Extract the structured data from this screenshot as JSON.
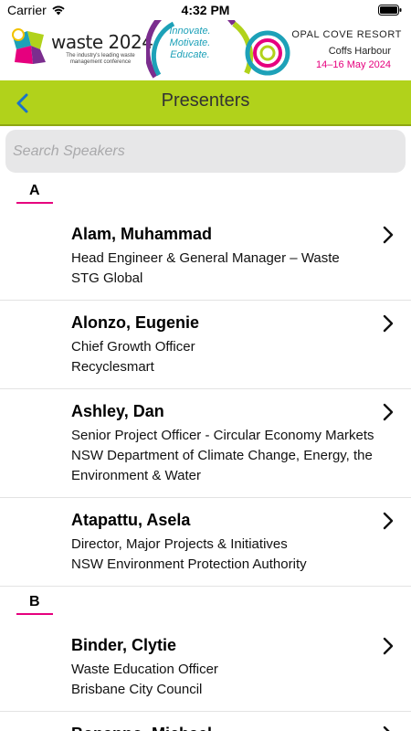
{
  "status_bar": {
    "carrier": "Carrier",
    "time": "4:32 PM"
  },
  "banner": {
    "logo_title": "waste 2024",
    "logo_tagline": "The industry's leading waste management conference",
    "motto": [
      "Innovate.",
      "Motivate.",
      "Educate."
    ],
    "venue": "OPAL COVE RESORT",
    "city": "Coffs Harbour",
    "dates": "14–16 May 2024"
  },
  "nav": {
    "title": "Presenters"
  },
  "search": {
    "placeholder": "Search Speakers"
  },
  "colors": {
    "nav_green": "#b1d21b",
    "accent_pink": "#e6007e",
    "back_blue": "#1a73c9"
  },
  "sections": [
    {
      "letter": "A",
      "speakers": [
        {
          "name": "Alam, Muhammad",
          "role": "Head Engineer & General Manager – Waste",
          "org": "STG Global"
        },
        {
          "name": "Alonzo, Eugenie",
          "role": "Chief Growth Officer",
          "org": "Recyclesmart"
        },
        {
          "name": "Ashley, Dan",
          "role": "Senior Project Officer - Circular Economy Markets",
          "org": "NSW Department of Climate Change, Energy, the Environment & Water"
        },
        {
          "name": "Atapattu, Asela",
          "role": "Director, Major Projects & Initiatives",
          "org": "NSW Environment Protection Authority"
        }
      ]
    },
    {
      "letter": "B",
      "speakers": [
        {
          "name": "Binder, Clytie",
          "role": "Waste Education Officer",
          "org": "Brisbane City Council"
        },
        {
          "name": "Bonanno, Michael",
          "role": "",
          "org": ""
        }
      ]
    }
  ]
}
